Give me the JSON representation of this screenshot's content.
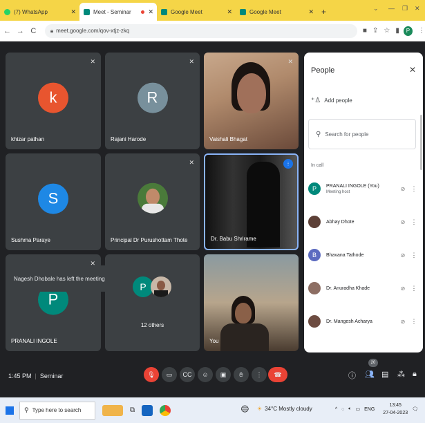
{
  "browser": {
    "tabs": [
      {
        "title": "(7) WhatsApp",
        "color": "#25d366"
      },
      {
        "title": "Meet - Seminar",
        "color": "#00897b"
      },
      {
        "title": "Google Meet",
        "color": "#00897b"
      },
      {
        "title": "Google Meet",
        "color": "#00897b"
      }
    ],
    "url": "meet.google.com/qov-xtjz-zkq",
    "profile_initial": "P"
  },
  "meet": {
    "tiles": [
      {
        "name": "khizar pathan",
        "initial": "k",
        "color": "#e8552f"
      },
      {
        "name": "Rajani Harode",
        "initial": "R",
        "color": "#78909c"
      },
      {
        "name": "Vaishali Bhagat"
      },
      {
        "name": "Sushma Paraye",
        "initial": "S",
        "color": "#1e88e5"
      },
      {
        "name": "Principal Dr Purushottam Thote"
      },
      {
        "name": "Dr. Babu Shrirame"
      },
      {
        "name": "PRANALI INGOLE",
        "initial": "P",
        "color": "#00897b"
      },
      {
        "name": "12 others",
        "initial": "P",
        "color": "#00897b"
      },
      {
        "name": "You"
      }
    ],
    "toast": "Nagesh Dhobale has left the meeting",
    "time": "1:45 PM",
    "meeting_name": "Seminar",
    "participant_count": "20"
  },
  "people_panel": {
    "title": "People",
    "add_people": "Add people",
    "search_placeholder": "Search for people",
    "section_label": "In call",
    "participants": [
      {
        "name": "PRANALI INGOLE (You)",
        "sub": "Meeting host",
        "initial": "P",
        "color": "#00897b"
      },
      {
        "name": "Abhay Dhote",
        "sub": "",
        "initial": "",
        "color": "#5d4037"
      },
      {
        "name": "Bhavana Tathode",
        "sub": "",
        "initial": "B",
        "color": "#5c6bc0"
      },
      {
        "name": "Dr. Anuradha Khade",
        "sub": "",
        "initial": "",
        "color": "#8d6e63"
      },
      {
        "name": "Dr. Mangesh Acharya",
        "sub": "",
        "initial": "",
        "color": "#6d4c41"
      }
    ]
  },
  "taskbar": {
    "search_placeholder": "Type here to search",
    "weather": "34°C Mostly cloudy",
    "lang": "ENG",
    "time": "13:45",
    "date": "27-04-2023"
  }
}
